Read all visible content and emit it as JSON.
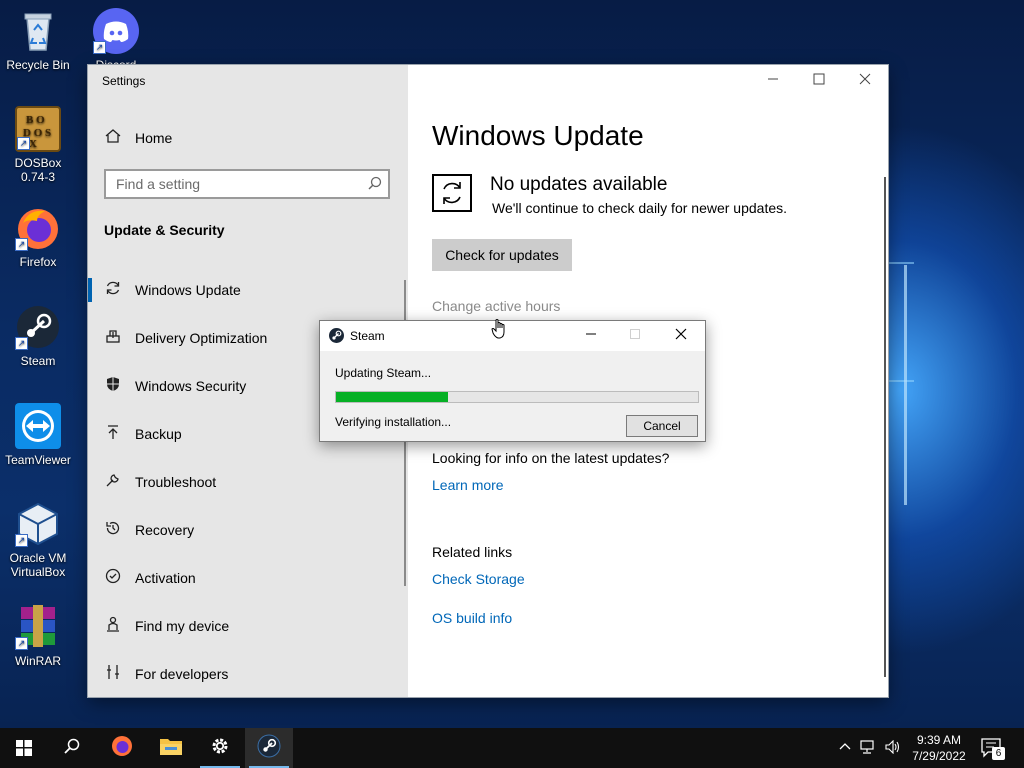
{
  "desktop": {
    "icons": [
      {
        "label": "Recycle Bin"
      },
      {
        "label": "Discord"
      },
      {
        "label": "DOSBox\n0.74-3"
      },
      {
        "label": "Firefox"
      },
      {
        "label": "Steam"
      },
      {
        "label": "TeamViewer"
      },
      {
        "label": "Oracle VM\nVirtualBox"
      },
      {
        "label": "WinRAR"
      }
    ]
  },
  "settings": {
    "window_title": "Settings",
    "home_label": "Home",
    "search_placeholder": "Find a setting",
    "section_title": "Update & Security",
    "sidebar_items": [
      {
        "label": "Windows Update",
        "icon": "refresh-icon",
        "active": true
      },
      {
        "label": "Delivery Optimization",
        "icon": "delivery-icon"
      },
      {
        "label": "Windows Security",
        "icon": "shield-icon"
      },
      {
        "label": "Backup",
        "icon": "backup-arrow-icon"
      },
      {
        "label": "Troubleshoot",
        "icon": "wrench-icon"
      },
      {
        "label": "Recovery",
        "icon": "recovery-icon"
      },
      {
        "label": "Activation",
        "icon": "checkmark-circle-icon"
      },
      {
        "label": "Find my device",
        "icon": "person-locate-icon"
      },
      {
        "label": "For developers",
        "icon": "developer-tools-icon"
      }
    ],
    "page_title": "Windows Update",
    "status_title": "No updates available",
    "status_subtitle": "We'll continue to check daily for newer updates.",
    "check_button": "Check for updates",
    "change_active_hours": "Change active hours",
    "info_question": "Looking for info on the latest updates?",
    "learn_more": "Learn more",
    "related_links_title": "Related links",
    "check_storage": "Check Storage",
    "os_build_info": "OS build info"
  },
  "steam_dialog": {
    "title": "Steam",
    "updating_text": "Updating Steam...",
    "progress_fraction": 0.31,
    "verifying_text": "Verifying installation...",
    "cancel_label": "Cancel",
    "progress_color": "#06b025"
  },
  "taskbar": {
    "time": "9:39 AM",
    "date": "7/29/2022",
    "notification_count": "6"
  }
}
